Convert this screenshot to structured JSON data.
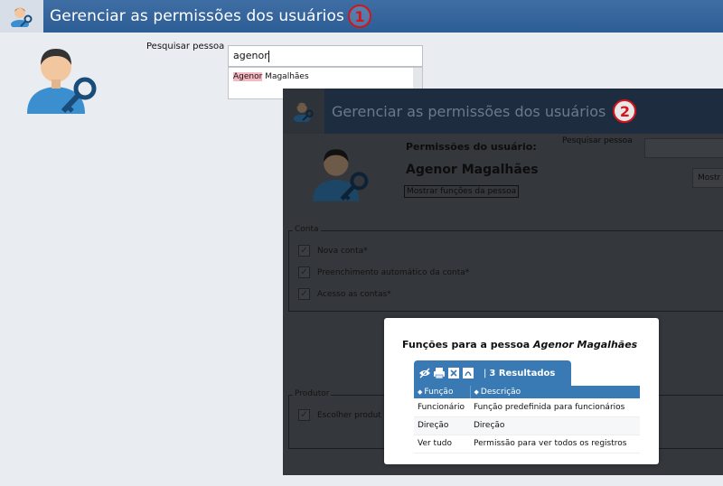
{
  "main": {
    "title": "Gerenciar as permissões dos usuários",
    "step": "1",
    "search_label": "Pesquisar pessoa",
    "search_value": "agenor",
    "suggestion": {
      "highlight": "Agenor",
      "rest": " Magalhães"
    }
  },
  "win2": {
    "title": "Gerenciar as permissões dos usuários",
    "step": "2",
    "perm_label": "Permissões do usuário:",
    "person_name": "Agenor Magalhães",
    "show_roles_link": "Mostrar funções da pessoa",
    "search_label": "Pesquisar pessoa",
    "button_label": "Mostr",
    "conta": {
      "legend": "Conta",
      "items": [
        "Nova conta*",
        "Preenchimento automático da conta*",
        "Acesso as contas*"
      ]
    },
    "produto": {
      "legend": "Produtor",
      "items": [
        "Escolher produt"
      ]
    }
  },
  "modal": {
    "title_prefix": "Funções para a pessoa ",
    "title_name": "Agenor Magalhães",
    "results": "3 Resultados",
    "columns": [
      "Função",
      "Descrição"
    ],
    "rows": [
      [
        "Funcionário",
        "Função predefinida para funcionários"
      ],
      [
        "Direção",
        "Direção"
      ],
      [
        "Ver tudo",
        "Permissão para ver todos os registros"
      ]
    ]
  },
  "colors": {
    "titlebar": "#2c5d95",
    "accent": "#3a7ab4",
    "badge": "#d4151b"
  }
}
